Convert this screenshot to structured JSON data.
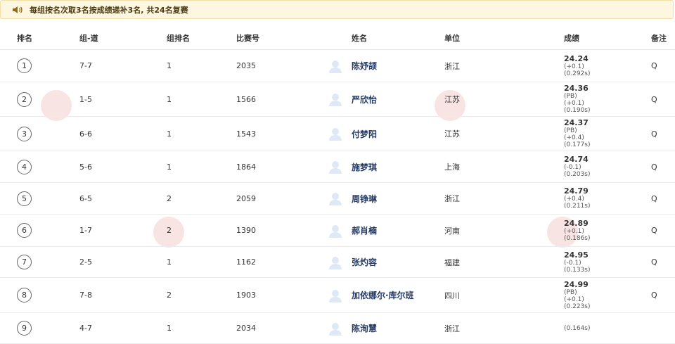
{
  "notice": {
    "icon": "speaker-icon",
    "text": "每组按名次取3名按成绩递补3名, 共24名复赛"
  },
  "headers": [
    "排名",
    "组-道",
    "组排名",
    "比赛号",
    "姓名",
    "单位",
    "成绩",
    "备注"
  ],
  "rows": [
    {
      "rank": "1",
      "lane": "7-7",
      "group_rank": "1",
      "bib": "2035",
      "name": "陈妤颉",
      "unit": "浙江",
      "time": "24.24",
      "pb": "",
      "wind": "(+0.1)",
      "reaction": "(0.292s)",
      "note": "Q"
    },
    {
      "rank": "2",
      "lane": "1-5",
      "group_rank": "1",
      "bib": "1566",
      "name": "严欣怡",
      "unit": "江苏",
      "time": "24.36",
      "pb": "(PB)",
      "wind": "(+0.1)",
      "reaction": "(0.190s)",
      "note": "Q"
    },
    {
      "rank": "3",
      "lane": "6-6",
      "group_rank": "1",
      "bib": "1543",
      "name": "付梦阳",
      "unit": "江苏",
      "time": "24.37",
      "pb": "(PB)",
      "wind": "(+0.4)",
      "reaction": "(0.177s)",
      "note": "Q"
    },
    {
      "rank": "4",
      "lane": "5-6",
      "group_rank": "1",
      "bib": "1864",
      "name": "施梦琪",
      "unit": "上海",
      "time": "24.74",
      "pb": "",
      "wind": "(-0.1)",
      "reaction": "(0.203s)",
      "note": "Q"
    },
    {
      "rank": "5",
      "lane": "6-5",
      "group_rank": "2",
      "bib": "2059",
      "name": "周铮琳",
      "unit": "浙江",
      "time": "24.79",
      "pb": "",
      "wind": "(+0.4)",
      "reaction": "(0.211s)",
      "note": "Q"
    },
    {
      "rank": "6",
      "lane": "1-7",
      "group_rank": "2",
      "bib": "1390",
      "name": "郝肖楠",
      "unit": "河南",
      "time": "24.89",
      "pb": "",
      "wind": "(+0.1)",
      "reaction": "(0.186s)",
      "note": "Q"
    },
    {
      "rank": "7",
      "lane": "2-5",
      "group_rank": "1",
      "bib": "1162",
      "name": "张灼容",
      "unit": "福建",
      "time": "24.95",
      "pb": "",
      "wind": "(-0.1)",
      "reaction": "(0.133s)",
      "note": "Q"
    },
    {
      "rank": "8",
      "lane": "7-8",
      "group_rank": "2",
      "bib": "1903",
      "name": "加依娜尔·库尔班",
      "unit": "四川",
      "time": "24.99",
      "pb": "(PB)",
      "wind": "(+0.1)",
      "reaction": "(0.223s)",
      "note": "Q"
    },
    {
      "rank": "9",
      "lane": "4-7",
      "group_rank": "1",
      "bib": "2034",
      "name": "陈洵慧",
      "unit": "浙江",
      "time": "",
      "pb": "",
      "wind": "",
      "reaction": "(0.164s)",
      "note": ""
    }
  ],
  "colors": {
    "notice_bg": "#fdf6e0",
    "name_text": "#243a62",
    "avatar": "#dfe8f5"
  }
}
